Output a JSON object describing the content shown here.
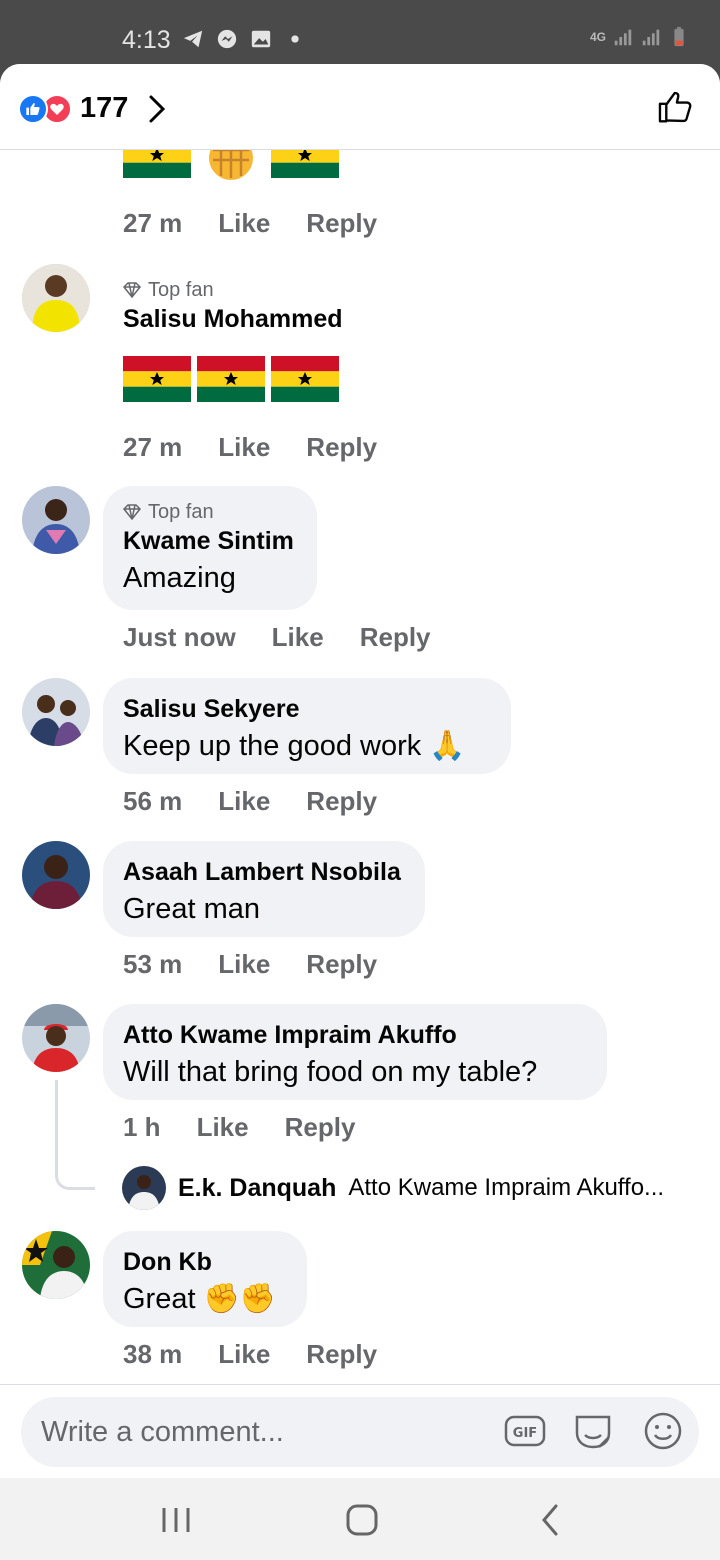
{
  "status_bar": {
    "time": "4:13",
    "network": "4G"
  },
  "header": {
    "reaction_count": "177"
  },
  "comments": [
    {
      "time": "27 m",
      "like": "Like",
      "reply": "Reply"
    },
    {
      "badge": "Top fan",
      "name": "Salisu Mohammed",
      "time": "27 m",
      "like": "Like",
      "reply": "Reply"
    },
    {
      "badge": "Top fan",
      "name": "Kwame Sintim",
      "text": "Amazing",
      "time": "Just now",
      "like": "Like",
      "reply": "Reply"
    },
    {
      "name": "Salisu Sekyere",
      "text": "Keep up the good work 🙏",
      "time": "56 m",
      "like": "Like",
      "reply": "Reply"
    },
    {
      "name": "Asaah Lambert Nsobila",
      "text": "Great man",
      "time": "53 m",
      "like": "Like",
      "reply": "Reply"
    },
    {
      "name": "Atto Kwame Impraim Akuffo",
      "text": "Will that bring food on my table?",
      "time": "1 h",
      "like": "Like",
      "reply": "Reply",
      "reply_preview": {
        "name": "E.k. Danquah",
        "text": "Atto Kwame Impraim Akuffo..."
      }
    },
    {
      "name": "Don Kb",
      "text": "Great ✊✊",
      "time": "38 m",
      "like": "Like",
      "reply": "Reply"
    }
  ],
  "composer": {
    "placeholder": "Write a comment..."
  },
  "colors": {
    "accent": "#1877f2",
    "love": "#f33e58",
    "bubble": "#f0f2f5",
    "meta": "#65676b"
  }
}
